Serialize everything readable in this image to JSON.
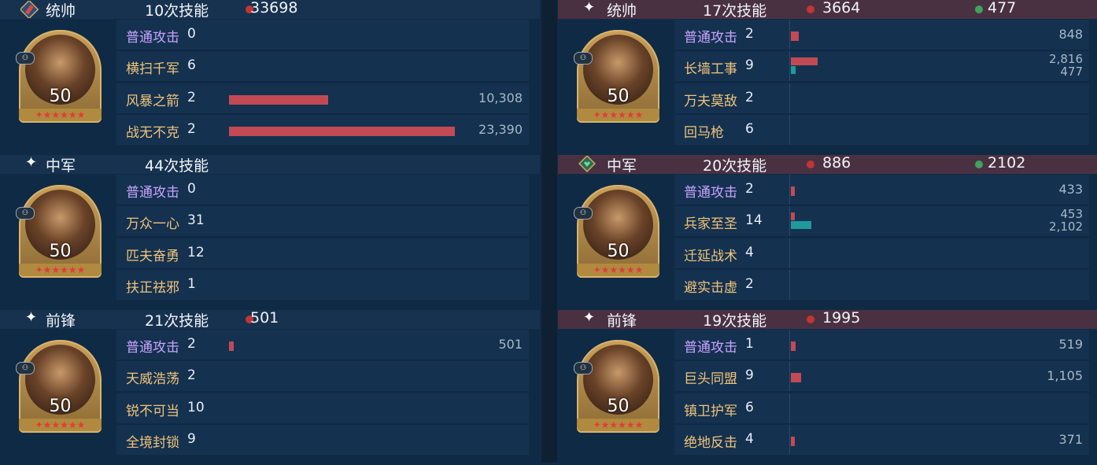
{
  "left": [
    {
      "position": "统帅",
      "skills_count": "10次技能",
      "damage": "33698",
      "level": "50",
      "rows": [
        {
          "name": "普通攻击",
          "count": "0",
          "value": "",
          "bar_fraction": 0
        },
        {
          "name": "横扫千军",
          "count": "6",
          "value": "",
          "bar_fraction": 0
        },
        {
          "name": "风暴之箭",
          "count": "2",
          "value": "10,308",
          "bar_fraction": 0.44
        },
        {
          "name": "战无不克",
          "count": "2",
          "value": "23,390",
          "bar_fraction": 1.0
        }
      ]
    },
    {
      "position": "中军",
      "skills_count": "44次技能",
      "damage": "",
      "level": "50",
      "rows": [
        {
          "name": "普通攻击",
          "count": "0",
          "value": "",
          "bar_fraction": 0
        },
        {
          "name": "万众一心",
          "count": "31",
          "value": "",
          "bar_fraction": 0
        },
        {
          "name": "匹夫奋勇",
          "count": "12",
          "value": "",
          "bar_fraction": 0
        },
        {
          "name": "扶正祛邪",
          "count": "1",
          "value": "",
          "bar_fraction": 0
        }
      ]
    },
    {
      "position": "前锋",
      "skills_count": "21次技能",
      "damage": "501",
      "level": "50",
      "rows": [
        {
          "name": "普通攻击",
          "count": "2",
          "value": "501",
          "bar_fraction": 0.02
        },
        {
          "name": "天威浩荡",
          "count": "2",
          "value": "",
          "bar_fraction": 0
        },
        {
          "name": "锐不可当",
          "count": "10",
          "value": "",
          "bar_fraction": 0
        },
        {
          "name": "全境封锁",
          "count": "9",
          "value": "",
          "bar_fraction": 0
        }
      ]
    }
  ],
  "right": [
    {
      "position": "统帅",
      "skills_count": "17次技能",
      "damage": "3664",
      "heal": "477",
      "level": "50",
      "rows": [
        {
          "name": "普通攻击",
          "count": "2",
          "value": "848",
          "heal_value": "",
          "bar_fraction": 0.3,
          "heal_fraction": 0
        },
        {
          "name": "长墙工事",
          "count": "9",
          "value": "2,816",
          "heal_value": "477",
          "bar_fraction": 1.0,
          "heal_fraction": 0.17
        },
        {
          "name": "万夫莫敌",
          "count": "2",
          "value": "",
          "heal_value": "",
          "bar_fraction": 0,
          "heal_fraction": 0
        },
        {
          "name": "回马枪",
          "count": "6",
          "value": "",
          "heal_value": "",
          "bar_fraction": 0,
          "heal_fraction": 0
        }
      ]
    },
    {
      "position": "中军",
      "skills_count": "20次技能",
      "damage": "886",
      "heal": "2102",
      "level": "50",
      "rows": [
        {
          "name": "普通攻击",
          "count": "2",
          "value": "433",
          "heal_value": "",
          "bar_fraction": 0.15,
          "heal_fraction": 0
        },
        {
          "name": "兵家至圣",
          "count": "14",
          "value": "453",
          "heal_value": "2,102",
          "bar_fraction": 0.16,
          "heal_fraction": 0.75
        },
        {
          "name": "迁延战术",
          "count": "4",
          "value": "",
          "heal_value": "",
          "bar_fraction": 0,
          "heal_fraction": 0
        },
        {
          "name": "避实击虚",
          "count": "2",
          "value": "",
          "heal_value": "",
          "bar_fraction": 0,
          "heal_fraction": 0
        }
      ]
    },
    {
      "position": "前锋",
      "skills_count": "19次技能",
      "damage": "1995",
      "heal": "",
      "level": "50",
      "rows": [
        {
          "name": "普通攻击",
          "count": "1",
          "value": "519",
          "heal_value": "",
          "bar_fraction": 0.18,
          "heal_fraction": 0
        },
        {
          "name": "巨头同盟",
          "count": "9",
          "value": "1,105",
          "heal_value": "",
          "bar_fraction": 0.39,
          "heal_fraction": 0
        },
        {
          "name": "镇卫护军",
          "count": "6",
          "value": "",
          "heal_value": "",
          "bar_fraction": 0,
          "heal_fraction": 0
        },
        {
          "name": "绝地反击",
          "count": "4",
          "value": "371",
          "heal_value": "",
          "bar_fraction": 0.13,
          "heal_fraction": 0
        }
      ]
    }
  ],
  "colors": {
    "damage": "#c24a55",
    "heal": "#1e9a9e",
    "skill_name": "#f0c37a",
    "normal_attack": "#c9a4ff"
  }
}
